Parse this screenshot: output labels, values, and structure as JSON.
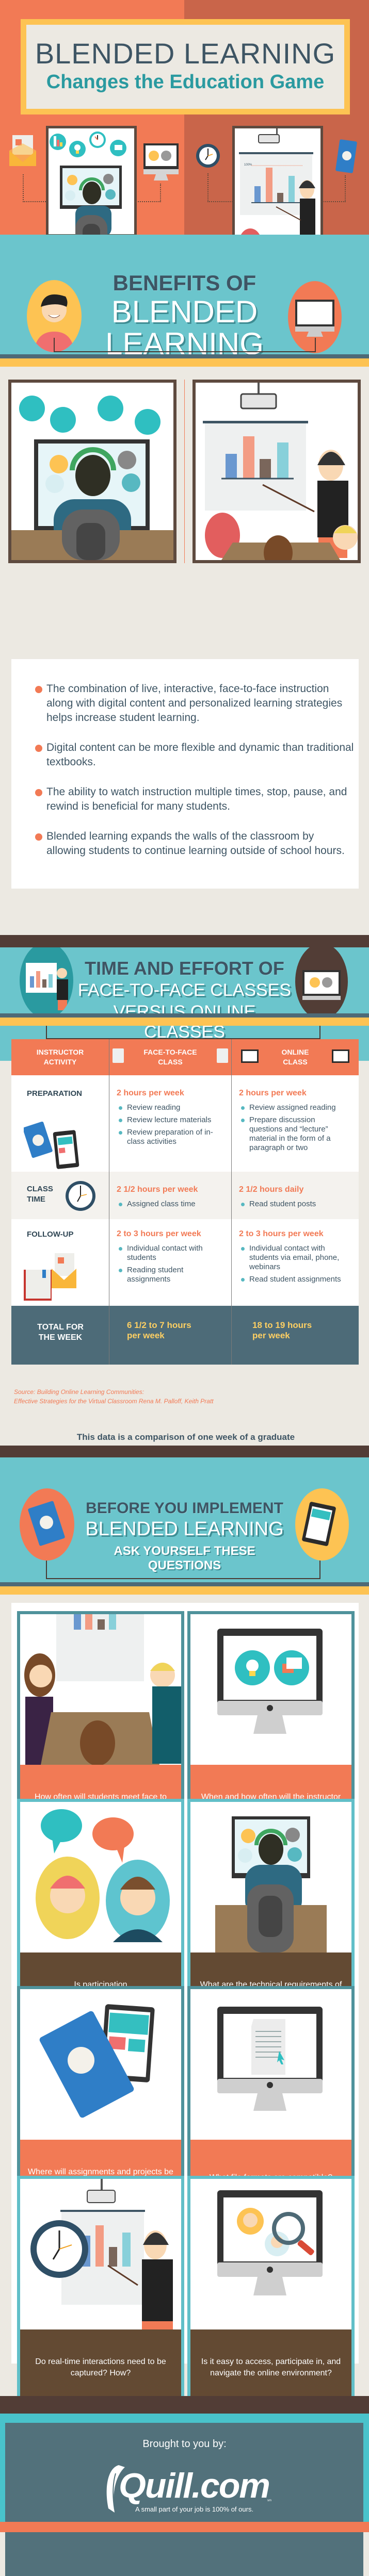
{
  "hero": {
    "title_line1": "BLENDED LEARNING",
    "title_line2": "Changes the Education Game",
    "chart_label": "100%",
    "colors": {
      "left_bg": "#f27a55",
      "right_bg": "#c9654a",
      "title_frame": "#fdc353",
      "subtitle": "#2a9aa0"
    }
  },
  "benefits": {
    "heading_line1": "BENEFITS OF",
    "heading_line2": "BLENDED",
    "heading_line3": "LEARNING",
    "items": [
      "The combination of live, interactive, face-to-face instruction along with digital content and personalized learning strategies helps increase student learning.",
      "Digital content can be more flexible and dynamic than traditional textbooks.",
      "The ability to watch instruction multiple times, stop, pause, and rewind is beneficial for many students.",
      "Blended learning expands the walls of the classroom by allowing students to continue learning outside of school hours."
    ]
  },
  "time_effort": {
    "heading_line1": "TIME AND EFFORT OF",
    "heading_line2": "FACE-TO-FACE CLASSES",
    "heading_line3": "VERSUS ONLINE CLASSES",
    "table": {
      "headers": [
        "INSTRUCTOR ACTIVITY",
        "FACE-TO-FACE CLASS",
        "ONLINE CLASS"
      ],
      "rows": [
        {
          "activity": "PREPARATION",
          "face_to_face": {
            "hours": "2 hours per week",
            "items": [
              "Review reading",
              "Review lecture materials",
              "Review preparation of in-class activities"
            ]
          },
          "online": {
            "hours": "2 hours per week",
            "items": [
              "Review assigned reading",
              "Prepare discussion questions and “lecture” material in the form of a paragraph or two"
            ]
          }
        },
        {
          "activity": "CLASS TIME",
          "face_to_face": {
            "hours": "2 1/2 hours per week",
            "items": [
              "Assigned class time"
            ]
          },
          "online": {
            "hours": "2 1/2 hours daily",
            "items": [
              "Read student posts"
            ]
          }
        },
        {
          "activity": "FOLLOW-UP",
          "face_to_face": {
            "hours": "2 to 3 hours per week",
            "items": [
              "Individual contact with students",
              "Reading student assignments"
            ]
          },
          "online": {
            "hours": "2 to 3 hours per week",
            "items": [
              "Individual contact with students via email, phone, webinars",
              "Read student assignments"
            ]
          }
        }
      ],
      "total": {
        "label": "TOTAL FOR THE WEEK",
        "face_to_face": "6 1/2 to 7 hours per week",
        "online": "18 to 19 hours per week"
      }
    },
    "source_line1": "Source: Building Online Learning Communities:",
    "source_line2": "Effective Strategies for the Virtual Classroom Rena M. Palloff, Keith Pratt",
    "note": "This data is a comparison of one week of a graduate level course (that usually met once a week for 2 ½ hours) and an online version of the course."
  },
  "questions": {
    "heading_line1": "BEFORE YOU IMPLEMENT",
    "heading_line2": "BLENDED LEARNING",
    "heading_line3": "ASK YOURSELF THESE QUESTIONS",
    "cards": [
      {
        "text": "How often will students meet face to face?",
        "style": "orange"
      },
      {
        "text": "When and how often will the instructor be actively present online?",
        "style": "orange"
      },
      {
        "text": "Is participation synchronous/asynchronous or both?",
        "style": "brown"
      },
      {
        "text": "What are the technical requirements of home computers?",
        "style": "brown"
      },
      {
        "text": "Where will assignments and projects be posted?",
        "style": "orange"
      },
      {
        "text": "What file formats are compatible?",
        "style": "orange"
      },
      {
        "text": "Do real-time interactions need to be captured? How?",
        "style": "brown"
      },
      {
        "text": "Is it easy to access, participate in, and navigate the online environment?",
        "style": "brown"
      }
    ]
  },
  "footer": {
    "brought_by": "Brought to you by:",
    "brand": "Quill.com",
    "brand_mark": "sm",
    "tagline": "A small part of your job is 100% of ours."
  }
}
